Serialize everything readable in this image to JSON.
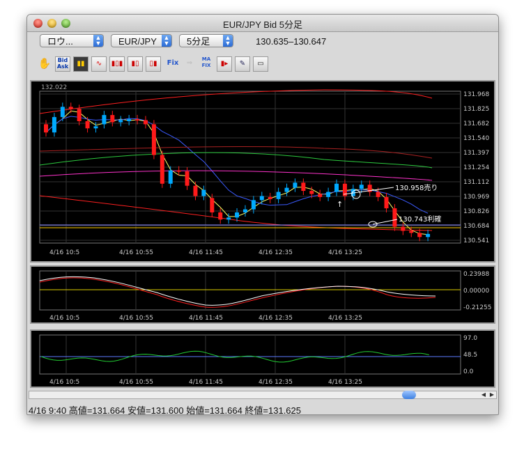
{
  "window": {
    "title": "EUR/JPY Bid 5分足"
  },
  "toolbar_top": {
    "chart_style": "ロウ...",
    "pair": "EUR/JPY",
    "timeframe": "5分足",
    "price_range": "130.635–130.647"
  },
  "icons": [
    "hand-icon",
    "bid-ask-icon",
    "candle-toggle-icon",
    "line-chart-icon",
    "candle-chart-icon",
    "candle-chart-2-icon",
    "candle-chart-3-icon",
    "fix-icon",
    "arrow-icon",
    "ma-fix-icon",
    "indicator-icon",
    "pen-icon",
    "print-icon"
  ],
  "icon_labels": {
    "bid": "Bid",
    "ask": "Ask",
    "fix": "Fix",
    "ma": "MA",
    "fix2": "FIX"
  },
  "main_chart": {
    "corner_label": "132.022",
    "y_ticks": [
      "131.968",
      "131.825",
      "131.682",
      "131.540",
      "131.397",
      "131.254",
      "131.112",
      "130.969",
      "130.826",
      "130.684",
      "130.541"
    ],
    "x_ticks": [
      "4/16 10:5",
      "4/16 10:55",
      "4/16 11:45",
      "4/16 12:35",
      "4/16 13:25"
    ],
    "annotations": {
      "sell": "130.958売り",
      "take_profit": "130.743利確"
    },
    "colors": {
      "up": "#00aaff",
      "down": "#ff1a1a",
      "ma_fast": "#ffff66",
      "ma_mid": "#3b5bff",
      "line_green": "#2ecc40",
      "line_magenta": "#ff33cc",
      "bands": "#ff2020"
    }
  },
  "osc1": {
    "y_ticks": [
      "0.23988",
      "0.00000",
      "-0.21255"
    ],
    "x_ticks": [
      "4/16 10:5",
      "4/16 10:55",
      "4/16 11:45",
      "4/16 12:35",
      "4/16 13:25"
    ]
  },
  "osc2": {
    "y_ticks": [
      "97.0",
      "48.5",
      "0.0"
    ],
    "x_ticks": [
      "4/16 10:5",
      "4/16 10:55",
      "4/16 11:45",
      "4/16 12:35",
      "4/16 13:25"
    ]
  },
  "status": {
    "text": "4/16 9:40 高値=131.664 安値=131.600 始値=131.664 終値=131.625"
  },
  "chart_data": {
    "type": "candlestick",
    "y_range": [
      130.541,
      132.022
    ],
    "candles": [
      [
        131.7,
        131.62
      ],
      [
        131.62,
        131.77
      ],
      [
        131.77,
        131.87
      ],
      [
        131.87,
        131.85
      ],
      [
        131.85,
        131.73
      ],
      [
        131.73,
        131.66
      ],
      [
        131.66,
        131.68
      ],
      [
        131.7,
        131.79
      ],
      [
        131.79,
        131.72
      ],
      [
        131.72,
        131.74
      ],
      [
        131.73,
        131.75
      ],
      [
        131.75,
        131.74
      ],
      [
        131.74,
        131.7
      ],
      [
        131.7,
        131.4
      ],
      [
        131.4,
        131.12
      ],
      [
        131.12,
        131.25
      ],
      [
        131.25,
        131.24
      ],
      [
        131.24,
        131.1
      ],
      [
        131.1,
        131.0
      ],
      [
        131.0,
        131.06
      ],
      [
        130.98,
        130.84
      ],
      [
        130.84,
        130.77
      ],
      [
        130.77,
        130.79
      ],
      [
        130.79,
        130.84
      ],
      [
        130.84,
        130.87
      ],
      [
        130.87,
        130.96
      ],
      [
        130.96,
        131.0
      ],
      [
        130.99,
        130.97
      ],
      [
        130.97,
        131.04
      ],
      [
        131.04,
        131.08
      ],
      [
        131.08,
        131.13
      ],
      [
        131.13,
        131.05
      ],
      [
        131.05,
        131.02
      ],
      [
        131.02,
        130.99
      ],
      [
        130.99,
        131.04
      ],
      [
        131.04,
        131.12
      ],
      [
        131.12,
        131.0
      ],
      [
        131.0,
        131.07
      ],
      [
        131.07,
        131.11
      ],
      [
        131.11,
        131.04
      ],
      [
        131.04,
        130.99
      ],
      [
        130.99,
        130.88
      ],
      [
        130.88,
        130.7
      ],
      [
        130.7,
        130.66
      ],
      [
        130.66,
        130.64
      ],
      [
        130.64,
        130.6
      ],
      [
        130.6,
        130.63
      ]
    ]
  }
}
